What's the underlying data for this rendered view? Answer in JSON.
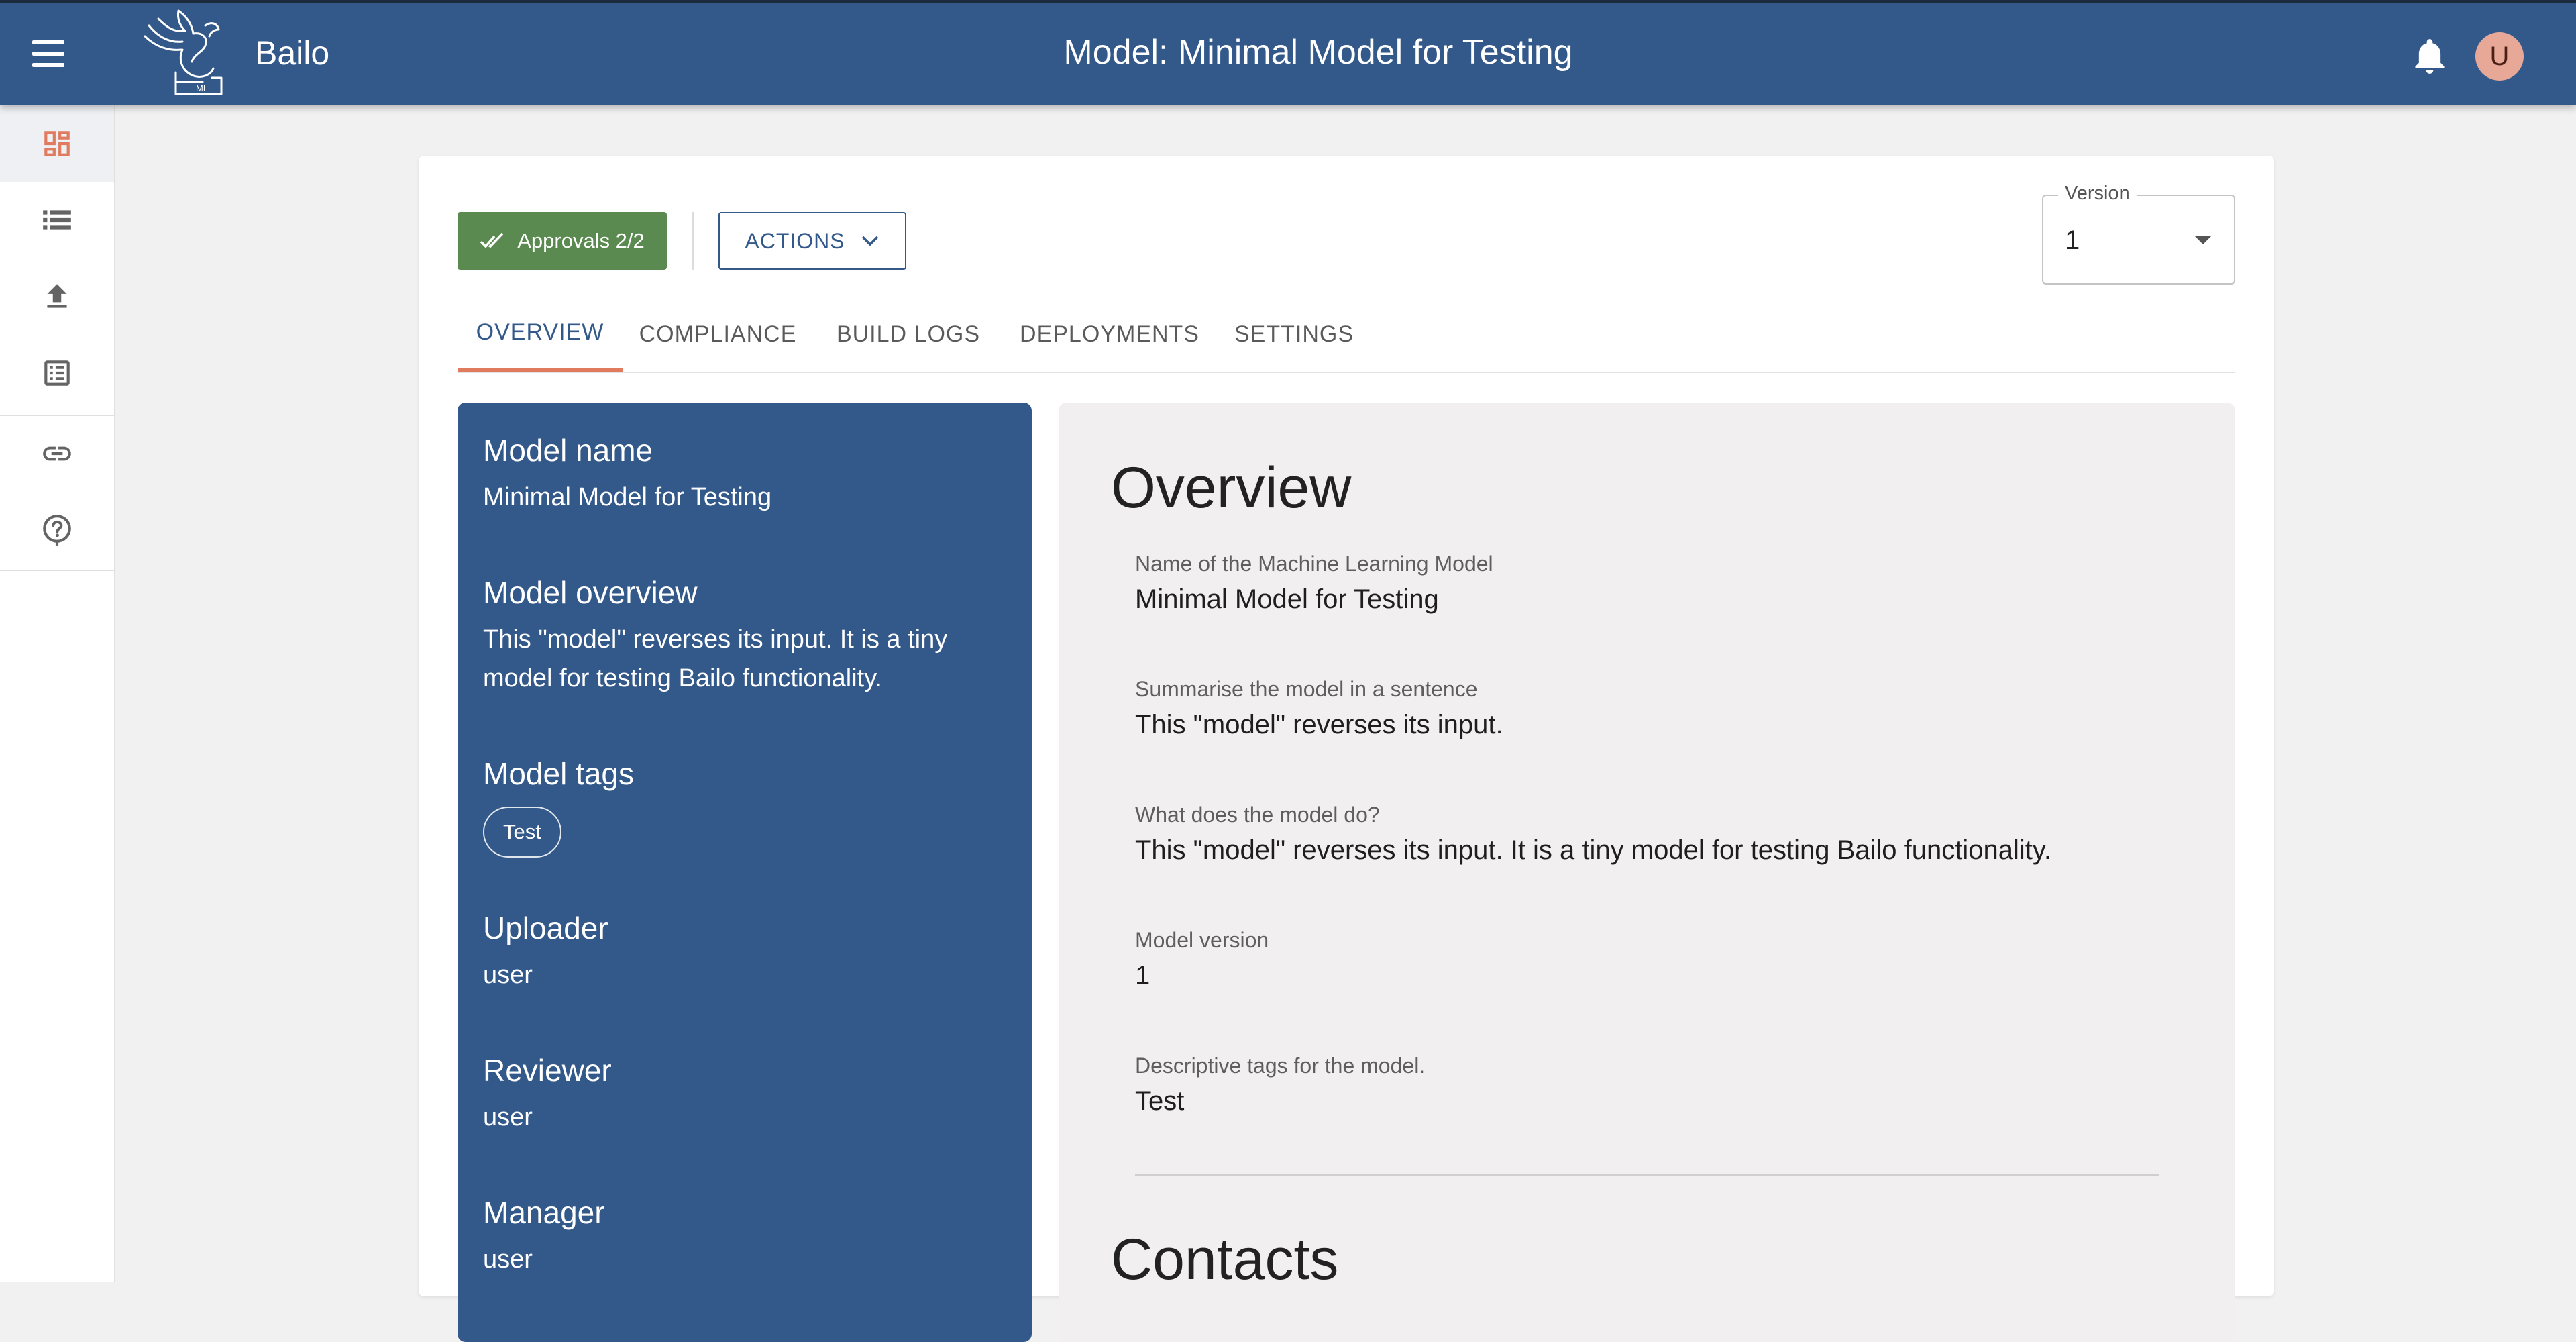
{
  "app": {
    "brand": "Bailo",
    "page_title": "Model: Minimal Model for Testing",
    "user_initial": "U"
  },
  "sidenav": {
    "items": [
      {
        "name": "dashboard-icon",
        "active": true
      },
      {
        "name": "list-icon",
        "active": false
      },
      {
        "name": "upload-icon",
        "active": false
      },
      {
        "name": "review-list-icon",
        "active": false
      },
      {
        "name": "link-icon",
        "active": false
      },
      {
        "name": "help-icon",
        "active": false
      }
    ]
  },
  "toolbar": {
    "approvals_label": "Approvals 2/2",
    "actions_label": "ACTIONS",
    "version_legend": "Version",
    "version_value": "1"
  },
  "tabs": [
    {
      "label": "OVERVIEW",
      "active": true
    },
    {
      "label": "COMPLIANCE",
      "active": false
    },
    {
      "label": "BUILD LOGS",
      "active": false
    },
    {
      "label": "DEPLOYMENTS",
      "active": false
    },
    {
      "label": "SETTINGS",
      "active": false
    }
  ],
  "summary": {
    "model_name_heading": "Model name",
    "model_name": "Minimal Model for Testing",
    "overview_heading": "Model overview",
    "overview": "This \"model\" reverses its input. It is a tiny model for testing Bailo functionality.",
    "tags_heading": "Model tags",
    "tags": [
      "Test"
    ],
    "uploader_heading": "Uploader",
    "uploader": "user",
    "reviewer_heading": "Reviewer",
    "reviewer": "user",
    "manager_heading": "Manager",
    "manager": "user"
  },
  "overview": {
    "title": "Overview",
    "fields": [
      {
        "label": "Name of the Machine Learning Model",
        "value": "Minimal Model for Testing"
      },
      {
        "label": "Summarise the model in a sentence",
        "value": "This \"model\" reverses its input."
      },
      {
        "label": "What does the model do?",
        "value": "This \"model\" reverses its input. It is a tiny model for testing Bailo functionality."
      },
      {
        "label": "Model version",
        "value": "1"
      },
      {
        "label": "Descriptive tags for the model.",
        "value": "Test"
      }
    ],
    "next_section_title": "Contacts"
  },
  "colors": {
    "primary": "#33588a",
    "accent": "#e07b5f",
    "success": "#5a8a4f",
    "avatar": "#e8a898"
  }
}
